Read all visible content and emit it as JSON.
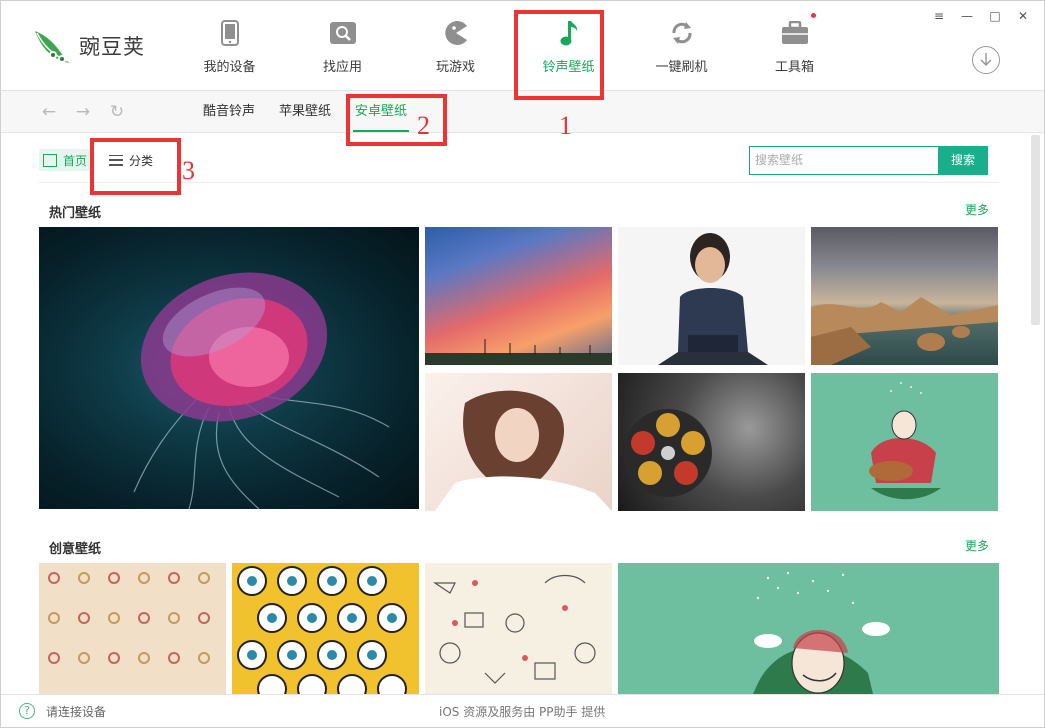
{
  "app": {
    "name": "豌豆荚"
  },
  "nav": {
    "items": [
      {
        "label": "我的设备",
        "icon": "phone-icon"
      },
      {
        "label": "找应用",
        "icon": "search-app-icon"
      },
      {
        "label": "玩游戏",
        "icon": "pacman-icon"
      },
      {
        "label": "铃声壁纸",
        "icon": "music-note-icon"
      },
      {
        "label": "一键刷机",
        "icon": "refresh-icon"
      },
      {
        "label": "工具箱",
        "icon": "toolbox-icon"
      }
    ],
    "active": "铃声壁纸"
  },
  "window_controls": [
    "≡",
    "—",
    "□",
    "✕"
  ],
  "subnav": {
    "tabs": [
      "酷音铃声",
      "苹果壁纸",
      "安卓壁纸"
    ],
    "active": "安卓壁纸"
  },
  "toolbar": {
    "home_label": "首页",
    "category_label": "分类",
    "search_placeholder": "搜索壁纸",
    "search_button": "搜索"
  },
  "sections": {
    "hot": {
      "title": "热门壁纸",
      "more": "更多"
    },
    "creative": {
      "title": "创意壁纸",
      "more": "更多"
    }
  },
  "annotations": [
    "1",
    "2",
    "3"
  ],
  "status": {
    "connection": "请连接设备",
    "provider": "iOS 资源及服务由 PP助手 提供"
  },
  "colors": {
    "accent": "#18a85a",
    "search_button": "#1aaf8b",
    "annotation": "#ee3333"
  }
}
